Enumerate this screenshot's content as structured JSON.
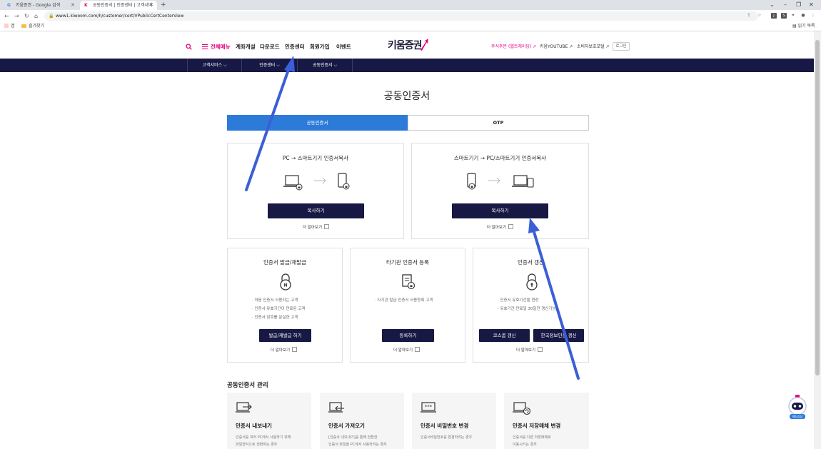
{
  "browser": {
    "tabs": [
      {
        "label": "키움증권 - Google 검색",
        "favicon": "G"
      },
      {
        "label": "공동인증서 | 인증센터 | 고객서비",
        "favicon": "K"
      }
    ],
    "url": "www1.kiwoom.com/h/customer/cert/VPublicCertCenterView",
    "bookmarks": {
      "apps": "앱",
      "favorites": "즐겨찾기",
      "reading_list": "읽기 목록"
    }
  },
  "header": {
    "menu_all": "전체메뉴",
    "nav": [
      "계좌개설",
      "다운로드",
      "인증센터",
      "회원가입",
      "이벤트"
    ],
    "logo": "키움증권",
    "utils": [
      "주식주문 (웹트레이딩) ↗",
      "키움YOUTUBE ↗",
      "소비자보호포털 ↗"
    ],
    "login": "로그인"
  },
  "subnav": [
    "고객서비스 ⌵",
    "인증센터 ⌵",
    "공동인증서 ⌵"
  ],
  "page_title": "공동인증서",
  "tabs": {
    "cert": "공동인증서",
    "otp": "OTP"
  },
  "copy_cards": [
    {
      "title": "PC → 스마트기기 인증서복사",
      "button": "복사하기",
      "more": "더 알아보기"
    },
    {
      "title": "스마트기기 → PC/스마트기기 인증서복사",
      "button": "복사하기",
      "more": "더 알아보기"
    }
  ],
  "service_cards": [
    {
      "title": "인증서 발급/재발급",
      "bullets": [
        "처음 인증서 사용하는 고객",
        "인증서 유효기간이 만료된 고객",
        "인증서 암호를 분실한 고객"
      ],
      "button": "발급/재발급 하기",
      "more": "더 알아보기"
    },
    {
      "title": "타기관 인증서 등록",
      "bullets": [
        "타기관 발급 인증서 사용등록 고객"
      ],
      "button": "등록하기",
      "more": "더 알아보기"
    },
    {
      "title": "인증서 갱신",
      "bullets": [
        "인증서 유효기간을 연장",
        "유효기간 만료일 30일전 갱신가능"
      ],
      "buttons": [
        "코스콤 갱신",
        "한국정보인증 갱신"
      ],
      "more": "더 알아보기"
    }
  ],
  "management": {
    "title": "공동인증서 관리",
    "items": [
      {
        "title": "인증서 내보내기",
        "desc": [
          "인증서를 여러 PC에서 사용하기 위해",
          "파일형식으로 전환하는 경우"
        ]
      },
      {
        "title": "인증서 가져오기",
        "desc": [
          "[인증서 내보내기]를 통해 전환한",
          "인증서 파일을 PC에서 사용하려는 경우"
        ]
      },
      {
        "title": "인증서 비밀번호 변경",
        "desc": [
          "인증서비밀번호를 변경하려는 경우"
        ]
      },
      {
        "title": "인증서 저장매체 변경",
        "desc": [
          "인증서를 다른 저장매체로",
          "이동시키는 경우"
        ]
      }
    ]
  },
  "chatbot_label": "채팅상담",
  "colors": {
    "brand_pink": "#e5007f",
    "navy": "#171844",
    "tab_blue": "#2d7bd9",
    "arrow_blue": "#3b5fd6"
  }
}
